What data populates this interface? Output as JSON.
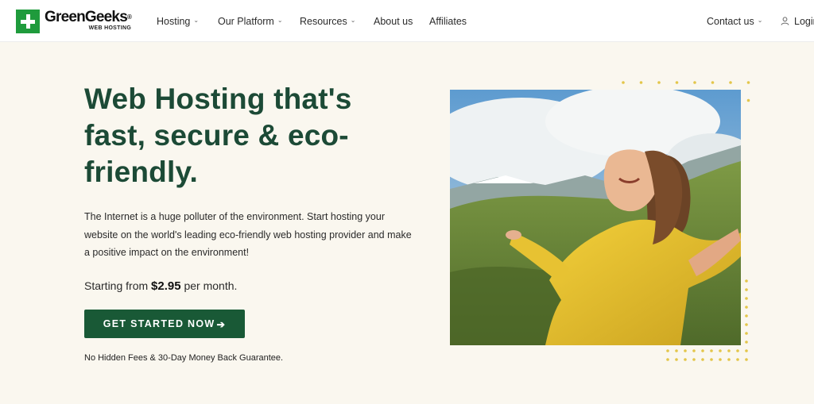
{
  "brand": {
    "name": "GreenGeeks",
    "registered": "®",
    "tagline": "WEB HOSTING"
  },
  "nav": {
    "hosting": "Hosting",
    "platform": "Our Platform",
    "resources": "Resources",
    "about": "About us",
    "affiliates": "Affiliates",
    "contact": "Contact us",
    "login": "Login"
  },
  "hero": {
    "headline_line1": "Web Hosting that's",
    "headline_line2": "fast, secure & eco-",
    "headline_line3": "friendly.",
    "description_line1": "The Internet is a huge polluter of the environment. Start hosting your",
    "description_line2": "website on the world's leading eco-friendly web hosting provider and make",
    "description_line3": "a positive impact on the environment!",
    "price_prefix": "Starting from",
    "price_value": "$2.95",
    "price_suffix": "per month.",
    "cta_label": "GET STARTED NOW",
    "cta_arrow": "➔",
    "guarantee": "No Hidden Fees & 30-Day Money Back Guarantee."
  },
  "colors": {
    "brand_green": "#1f9b3c",
    "headline_green": "#1c4a36",
    "cta_green": "#195936",
    "dot_yellow": "#e3c64a",
    "background": "#faf7ef"
  },
  "icons": {
    "chevron": "chevron-down-icon",
    "user": "user-icon",
    "logo": "plus-logo-icon"
  }
}
